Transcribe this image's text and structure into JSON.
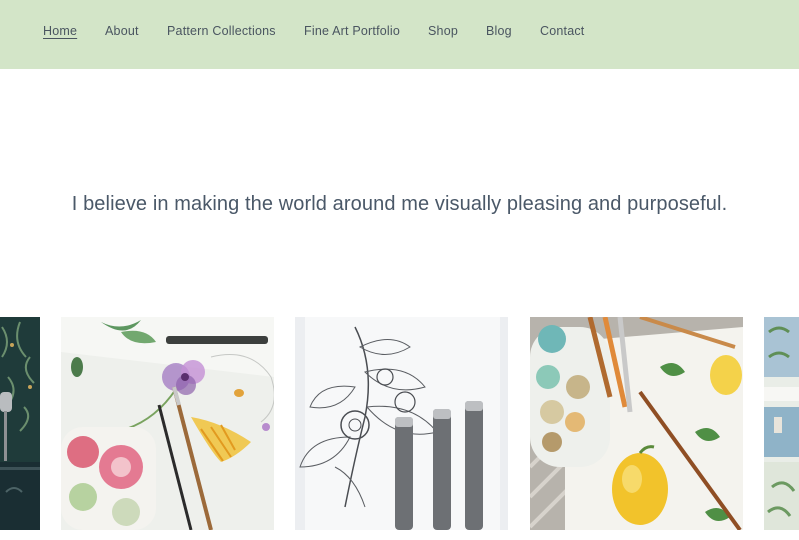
{
  "nav": {
    "items": [
      {
        "label": "Home",
        "active": true
      },
      {
        "label": "About"
      },
      {
        "label": "Pattern Collections"
      },
      {
        "label": "Fine Art Portfolio"
      },
      {
        "label": "Shop"
      },
      {
        "label": "Blog"
      },
      {
        "label": "Contact"
      }
    ]
  },
  "tagline": "I believe in making the world around me visually pleasing and purposeful.",
  "colors": {
    "nav_background": "#d3e5c8",
    "nav_text": "#4a5560",
    "tagline_text": "#4a5868"
  }
}
